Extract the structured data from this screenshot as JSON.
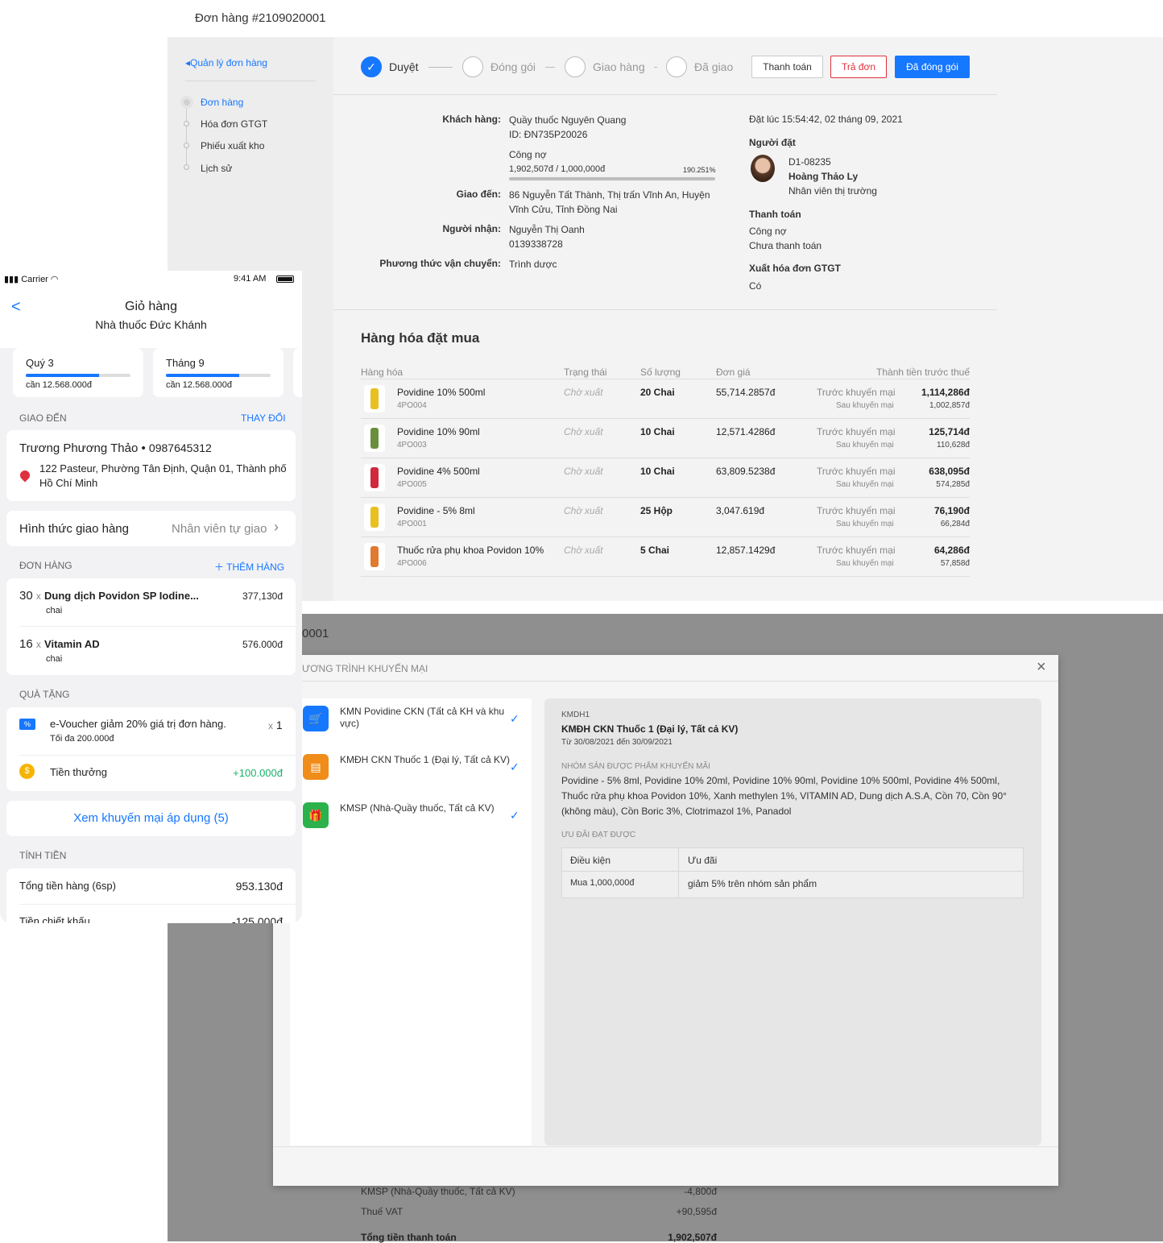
{
  "order": {
    "title": "Đơn hàng #2109020001",
    "breadcrumb": "Quản lý đơn hàng",
    "nav": [
      "Đơn hàng",
      "Hóa đơn GTGT",
      "Phiếu xuất kho",
      "Lịch sử"
    ],
    "steps": [
      "Duyệt",
      "Đóng gói",
      "Giao hàng",
      "Đã giao"
    ],
    "buttons": {
      "pay": "Thanh toán",
      "return": "Trả đơn",
      "packed": "Đã đóng gói"
    },
    "customer_label": "Khách hàng:",
    "customer_name": "Quầy thuốc Nguyên Quang",
    "customer_id": "ID: ĐN735P20026",
    "debt_label": "Công nợ",
    "debt_value": "1,902,507đ / 1,000,000đ",
    "debt_percent_text": "190.251%",
    "debt_fill": 1.0,
    "ship_label": "Giao đến:",
    "ship_addr1": "86 Nguyễn Tất Thành, Thị trấn Vĩnh An, Huyện",
    "ship_addr2": "Vĩnh Cửu, Tỉnh Đồng Nai",
    "receiver_label": "Người nhận:",
    "receiver_name": "Nguyễn Thị Oanh",
    "receiver_phone": "0139338728",
    "method_label": "Phương thức vận chuyển:",
    "method_value": "Trình dược",
    "placed_at": "Đặt lúc 15:54:42, 02 tháng 09, 2021",
    "placer_title": "Người đặt",
    "placer_code": "D1-08235",
    "placer_name": "Hoàng Thảo Ly",
    "placer_role": "Nhân viên thị trường",
    "payment_title": "Thanh toán",
    "payment_method": "Công nợ",
    "payment_status": "Chưa thanh toán",
    "vat_title": "Xuất hóa đơn GTGT",
    "vat_value": "Có",
    "goods_title": "Hàng hóa đặt mua",
    "columns": [
      "Hàng hóa",
      "Trạng thái",
      "Số lượng",
      "Đơn giá",
      "Thành tiền trước thuế"
    ],
    "before_label": "Trước khuyến mại",
    "after_label": "Sau khuyến mại",
    "rows": [
      {
        "name": "Povidine 10% 500ml",
        "code": "4PO004",
        "status": "Chờ xuất",
        "qty": "20 Chai",
        "price": "55,714.2857đ",
        "before": "1,114,286đ",
        "after": "1,002,857đ",
        "color": "#e8c020"
      },
      {
        "name": "Povidine 10% 90ml",
        "code": "4PO003",
        "status": "Chờ xuất",
        "qty": "10 Chai",
        "price": "12,571.4286đ",
        "before": "125,714đ",
        "after": "110,628đ",
        "color": "#6a8f3c"
      },
      {
        "name": "Povidine 4% 500ml",
        "code": "4PO005",
        "status": "Chờ xuất",
        "qty": "10 Chai",
        "price": "63,809.5238đ",
        "before": "638,095đ",
        "after": "574,285đ",
        "color": "#d0283c"
      },
      {
        "name": "Povidine - 5% 8ml",
        "code": "4PO001",
        "status": "Chờ xuất",
        "qty": "25 Hộp",
        "price": "3,047.619đ",
        "before": "76,190đ",
        "after": "66,284đ",
        "color": "#e8c020"
      },
      {
        "name": "Thuốc rửa phụ khoa Povidon 10%",
        "code": "4PO006",
        "status": "Chờ xuất",
        "qty": "5 Chai",
        "price": "12,857.1429đ",
        "before": "64,286đ",
        "after": "57,858đ",
        "color": "#e07a30"
      }
    ],
    "summary": [
      {
        "label": "KMSP (Nhà-Quầy thuốc, Tất cả KV)",
        "value": "-4,800đ"
      },
      {
        "label": "Thuế VAT",
        "value": "+90,595đ"
      },
      {
        "label": "Tổng tiền thanh toán",
        "value": "1,902,507đ"
      }
    ],
    "second_title_fragment": "0001"
  },
  "modal": {
    "title": "ƯƠNG TRÌNH KHUYẾN MẠI",
    "close": "×",
    "promos": [
      {
        "line1": "KMN Povidine CKN (Tất cả KH và khu",
        "line2": "vực)",
        "color": "#1677ff",
        "icon": "cart-icon"
      },
      {
        "line1": "KMĐH CKN Thuốc 1 (Đại lý, Tất cả KV)",
        "line2": "",
        "color": "#f08c1a",
        "icon": "receipt-icon"
      },
      {
        "line1": "KMSP (Nhà-Quầy thuốc, Tất cả KV)",
        "line2": "",
        "color": "#2bb24c",
        "icon": "gift-icon"
      }
    ],
    "detail_code": "KMDH1",
    "detail_title": "KMĐH CKN Thuốc 1 (Đại lý, Tất cả KV)",
    "detail_dates": "Từ 30/08/2021 đến 30/09/2021",
    "group_title": "NHÓM SẢN ĐƯỢC PHẨM KHUYẾN MÃI",
    "group_line1": "Povidine - 5% 8ml, Povidine 10% 20ml, Povidine 10% 90ml, Povidine 10% 500ml, Povidine 4% 500ml,",
    "group_line2": "Thuốc rửa phụ khoa Povidon 10%, Xanh methylen 1%, VITAMIN AD, Dung dịch A.S.A, Cồn 70, Cồn 90°",
    "group_line3": "(không màu), Cồn Boric 3%, Clotrimazol 1%, Panadol",
    "benefit_title": "ƯU ĐÃI ĐẠT ĐƯỢC",
    "benefit_head": [
      "Điều kiện",
      "Ưu đãi"
    ],
    "benefit_row": [
      "Mua 1,000,000đ",
      "giảm 5% trên nhóm sản phẩm"
    ]
  },
  "phone": {
    "carrier": "Carrier",
    "time": "9:41 AM",
    "title": "Giỏ hàng",
    "subtitle": "Nhà thuốc Đức Khánh",
    "quotas": [
      {
        "title": "Quý 3",
        "sub": "cần 12.568.000đ",
        "fill": 0.7
      },
      {
        "title": "Tháng 9",
        "sub": "cần 12.568.000đ",
        "fill": 0.7
      }
    ],
    "deliver_label": "GIAO ĐẾN",
    "change_label": "THAY ĐỔI",
    "recipient": "Trương Phương Thảo",
    "recipient_phone": "0987645312",
    "address1": "122 Pasteur, Phường Tân Định, Quận 01, Thành phố",
    "address2": "Hồ Chí Minh",
    "delivery_label": "Hình thức giao hàng",
    "delivery_value": "Nhân viên tự giao",
    "order_label": "ĐƠN HÀNG",
    "add_label": "THÊM HÀNG",
    "items": [
      {
        "qty": "30",
        "name": "Dung dịch Povidon SP Iodine...",
        "unit": "chai",
        "price": "377,130đ"
      },
      {
        "qty": "16",
        "name": "Vitamin AD",
        "unit": "chai",
        "price": "576.000đ"
      }
    ],
    "gift_label": "QUÀ TẶNG",
    "voucher": "e-Voucher giảm 20% giá trị đơn hàng.",
    "voucher_max": "Tối đa 200.000đ",
    "voucher_qty": "1",
    "bonus_label": "Tiền thưởng",
    "bonus_value": "+100.000đ",
    "promo_link": "Xem khuyến mại áp dụng (5)",
    "calc_label": "TÍNH TIỀN",
    "total_label": "Tổng tiền hàng (6sp)",
    "total_value": "953.130đ",
    "discount_label": "Tiền chiết khấu",
    "discount_value": "-125.000đ"
  }
}
